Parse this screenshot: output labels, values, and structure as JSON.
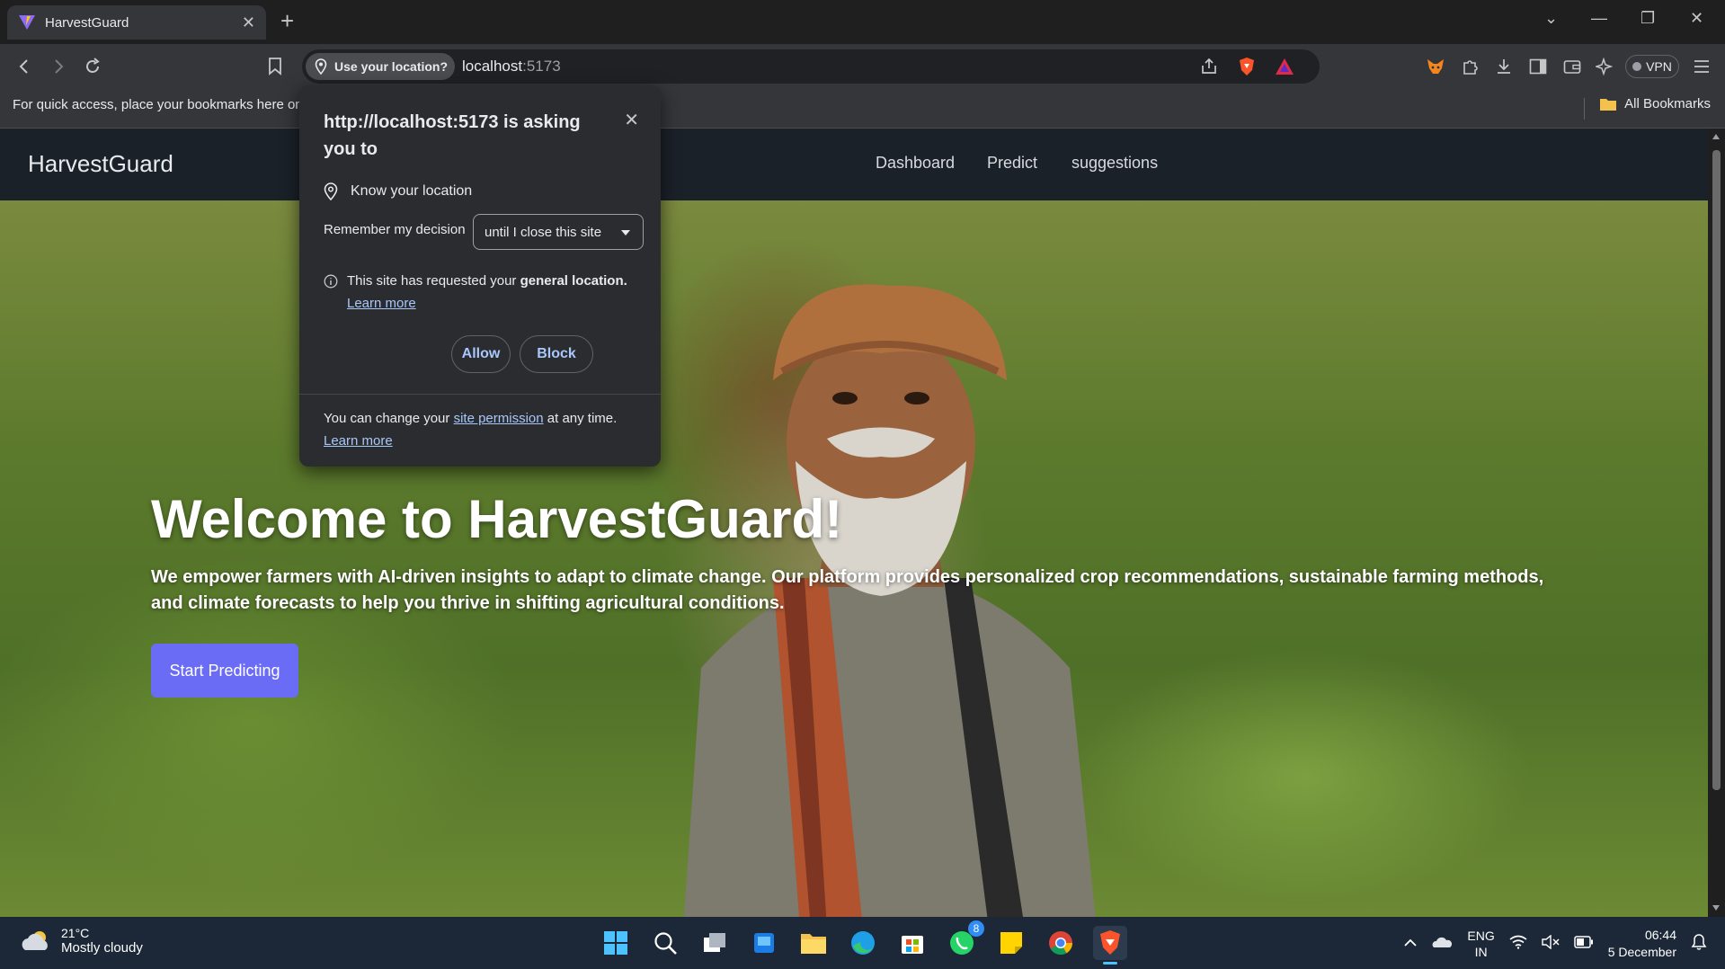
{
  "browser": {
    "tab_title": "HarvestGuard",
    "location_chip": "Use your location?",
    "url_host": "localhost",
    "url_port": ":5173",
    "vpn_label": "VPN",
    "bookmarks_hint": "For quick access, place your bookmarks here on",
    "all_bookmarks": "All Bookmarks"
  },
  "site": {
    "brand": "HarvestGuard",
    "nav": [
      "Dashboard",
      "Predict",
      "suggestions"
    ],
    "hero_title": "Welcome to HarvestGuard!",
    "hero_desc": "We empower farmers with AI-driven insights to adapt to climate change. Our platform provides personalized crop recommendations, sustainable farming methods, and climate forecasts to help you thrive in shifting agricultural conditions.",
    "cta": "Start Predicting"
  },
  "permission": {
    "title": "http://localhost:5173 is asking you to",
    "capability": "Know your location",
    "remember_label": "Remember my decision",
    "remember_value": "until I close this site",
    "info_prefix": "This site has requested your ",
    "info_bold": "general location.",
    "learn_more": "Learn more",
    "allow": "Allow",
    "block": "Block",
    "footer_prefix": "You can change your ",
    "footer_link": "site permission",
    "footer_suffix": " at any time.",
    "footer_learn_more": "Learn more"
  },
  "taskbar": {
    "temperature": "21°C",
    "weather": "Mostly cloudy",
    "whatsapp_badge": "8",
    "lang_1": "ENG",
    "lang_2": "IN",
    "time": "06:44",
    "date": "5 December"
  },
  "colors": {
    "cta": "#6b6cf5",
    "nav_bg": "#1b2129",
    "link": "#a8c7fa",
    "taskbar": "#1c2838"
  }
}
